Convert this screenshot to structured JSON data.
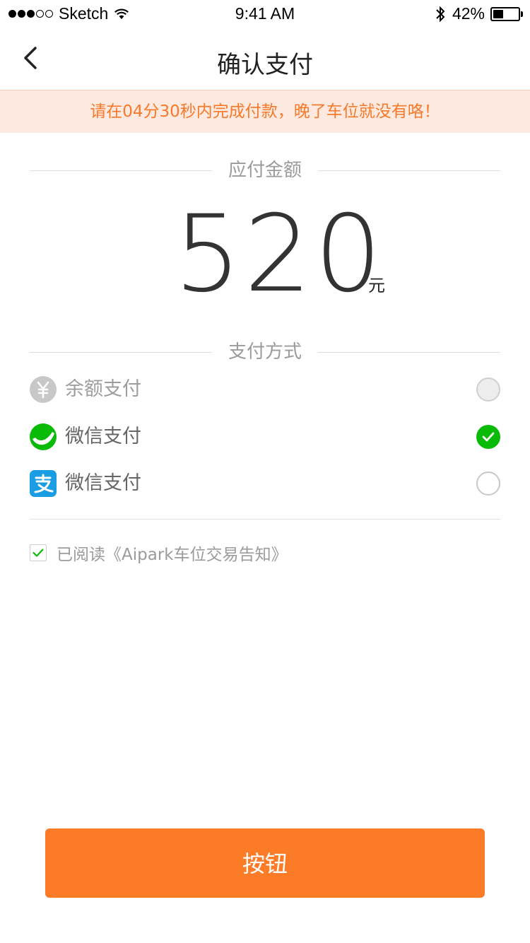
{
  "status_bar": {
    "carrier": "Sketch",
    "time": "9:41 AM",
    "battery": "42%",
    "battery_level": 0.42
  },
  "nav": {
    "title": "确认支付"
  },
  "notice": {
    "text": "请在04分30秒内完成付款，晚了车位就没有咯！"
  },
  "amount_section": {
    "label": "应付金额",
    "value": "520",
    "unit": "元"
  },
  "payment_section": {
    "label": "支付方式",
    "methods": [
      {
        "label": "余额支付",
        "icon": "yuan-icon",
        "state": "disabled"
      },
      {
        "label": "微信支付",
        "icon": "wechat-icon",
        "state": "selected"
      },
      {
        "label": "微信支付",
        "icon": "alipay-icon",
        "state": "unselected"
      }
    ]
  },
  "agreement": {
    "text": "已阅读《Aipark车位交易告知》",
    "checked": true
  },
  "button": {
    "label": "按钮"
  },
  "colors": {
    "accent": "#fc7b26",
    "notice_bg": "#fde9df",
    "notice_text": "#f7792a",
    "wechat_green": "#09bb07",
    "alipay_blue": "#1a9de2"
  }
}
